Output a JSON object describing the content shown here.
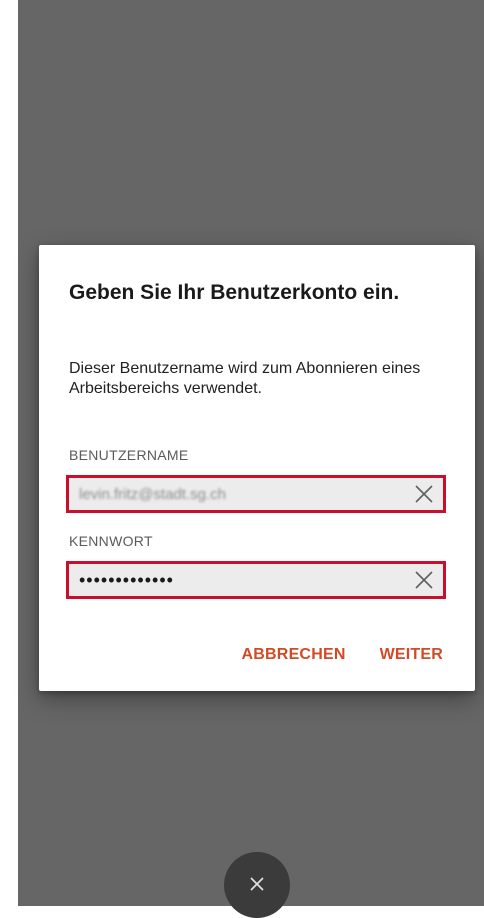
{
  "dialog": {
    "title": "Geben Sie Ihr Benutzerkonto ein.",
    "description": "Dieser Benutzername wird zum Abonnieren eines Arbeitsbereichs verwendet.",
    "username": {
      "label": "BENUTZERNAME",
      "value": "levin.fritz@stadt.sg.ch"
    },
    "password": {
      "label": "KENNWORT",
      "value": "•••••••••••••"
    },
    "buttons": {
      "cancel": "ABBRECHEN",
      "next": "WEITER"
    }
  },
  "icons": {
    "clear": "close-x-icon",
    "fab": "close-x-icon"
  },
  "colors": {
    "accent": "#d14b26",
    "highlight_border": "#c8102e",
    "overlay": "#666666",
    "fab": "#3b3b3b"
  }
}
